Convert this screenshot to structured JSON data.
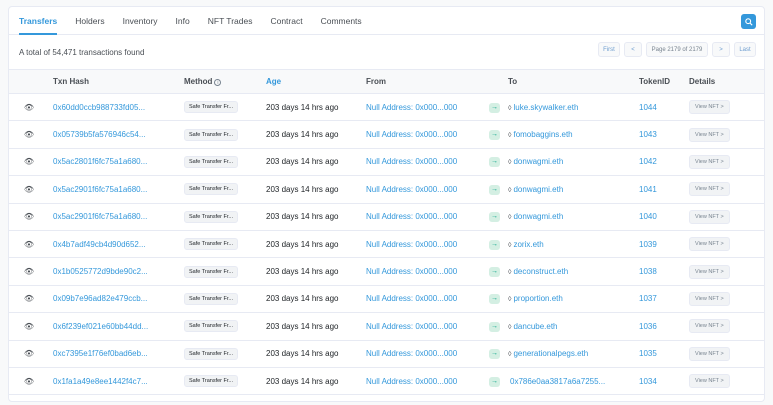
{
  "tabs": [
    {
      "label": "Transfers"
    },
    {
      "label": "Holders"
    },
    {
      "label": "Inventory"
    },
    {
      "label": "Info"
    },
    {
      "label": "NFT Trades"
    },
    {
      "label": "Contract"
    },
    {
      "label": "Comments"
    }
  ],
  "summary": "A total of 54,471 transactions found",
  "pager": {
    "first": "First",
    "prev": "<",
    "page": "Page 2179 of 2179",
    "next": ">",
    "last": "Last"
  },
  "columns": {
    "txn_hash": "Txn Hash",
    "method": "Method",
    "age": "Age",
    "from": "From",
    "to": "To",
    "token_id": "TokenID",
    "details": "Details"
  },
  "rows": [
    {
      "hash": "0x60dd0ccb988733fd05...",
      "method": "Safe Transfer Fr...",
      "age": "203 days 14 hrs ago",
      "from": "Null Address: 0x000...000",
      "to": "luke.skywalker.eth",
      "to_icon": "◊",
      "token": "1044",
      "details": "View NFT >"
    },
    {
      "hash": "0x05739b5fa576946c54...",
      "method": "Safe Transfer Fr...",
      "age": "203 days 14 hrs ago",
      "from": "Null Address: 0x000...000",
      "to": "fomobaggins.eth",
      "to_icon": "◊",
      "token": "1043",
      "details": "View NFT >"
    },
    {
      "hash": "0x5ac2801f6fc75a1a680...",
      "method": "Safe Transfer Fr...",
      "age": "203 days 14 hrs ago",
      "from": "Null Address: 0x000...000",
      "to": "donwagmi.eth",
      "to_icon": "◊",
      "token": "1042",
      "details": "View NFT >"
    },
    {
      "hash": "0x5ac2901f6fc75a1a680...",
      "method": "Safe Transfer Fr...",
      "age": "203 days 14 hrs ago",
      "from": "Null Address: 0x000...000",
      "to": "donwagmi.eth",
      "to_icon": "◊",
      "token": "1041",
      "details": "View NFT >"
    },
    {
      "hash": "0x5ac2901f6fc75a1a680...",
      "method": "Safe Transfer Fr...",
      "age": "203 days 14 hrs ago",
      "from": "Null Address: 0x000...000",
      "to": "donwagmi.eth",
      "to_icon": "◊",
      "token": "1040",
      "details": "View NFT >"
    },
    {
      "hash": "0x4b7adf49cb4d90d652...",
      "method": "Safe Transfer Fr...",
      "age": "203 days 14 hrs ago",
      "from": "Null Address: 0x000...000",
      "to": "zorix.eth",
      "to_icon": "◊",
      "token": "1039",
      "details": "View NFT >"
    },
    {
      "hash": "0x1b0525772d9bde90c2...",
      "method": "Safe Transfer Fr...",
      "age": "203 days 14 hrs ago",
      "from": "Null Address: 0x000...000",
      "to": "deconstruct.eth",
      "to_icon": "◊",
      "token": "1038",
      "details": "View NFT >"
    },
    {
      "hash": "0x09b7e96ad82e479ccb...",
      "method": "Safe Transfer Fr...",
      "age": "203 days 14 hrs ago",
      "from": "Null Address: 0x000...000",
      "to": "proportion.eth",
      "to_icon": "◊",
      "token": "1037",
      "details": "View NFT >"
    },
    {
      "hash": "0x6f239ef021e60bb44dd...",
      "method": "Safe Transfer Fr...",
      "age": "203 days 14 hrs ago",
      "from": "Null Address: 0x000...000",
      "to": "dancube.eth",
      "to_icon": "◊",
      "token": "1036",
      "details": "View NFT >"
    },
    {
      "hash": "0xc7395e1f76ef0bad6eb...",
      "method": "Safe Transfer Fr...",
      "age": "203 days 14 hrs ago",
      "from": "Null Address: 0x000...000",
      "to": "generationalpegs.eth",
      "to_icon": "◊",
      "token": "1035",
      "details": "View NFT >"
    },
    {
      "hash": "0x1fa1a49e8ee1442f4c7...",
      "method": "Safe Transfer Fr...",
      "age": "203 days 14 hrs ago",
      "from": "Null Address: 0x000...000",
      "to": "0x786e0aa3817a6a7255...",
      "to_icon": "",
      "token": "1034",
      "details": "View NFT >"
    }
  ],
  "icons": {
    "eye": "eye-icon",
    "arrow": "arrow-right-icon",
    "search": "search-icon",
    "info": "info-icon"
  },
  "colors": {
    "accent": "#3498db",
    "success": "#00a186"
  }
}
